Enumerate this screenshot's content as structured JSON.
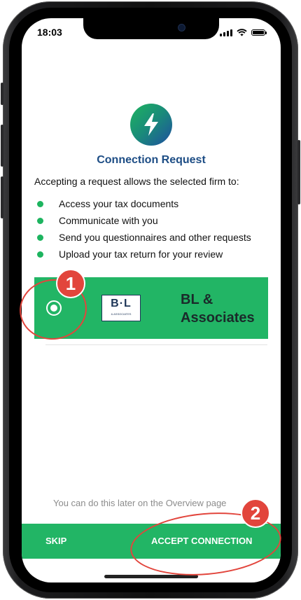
{
  "status_bar": {
    "time": "18:03"
  },
  "header": {
    "title": "Connection Request"
  },
  "intro": "Accepting a request allows the selected firm to:",
  "permissions": [
    "Access your tax documents",
    "Communicate with you",
    "Send you questionnaires and other requests",
    "Upload your tax return for your review"
  ],
  "firm": {
    "logo_text": "B·L",
    "logo_subtext": "& ASSOCIATES",
    "name_line1": "BL &",
    "name_line2": "Associates",
    "selected": true
  },
  "footer": {
    "note": "You can do this later on the Overview page",
    "skip_label": "SKIP",
    "accept_label": "ACCEPT CONNECTION"
  },
  "annotations": {
    "step1": "1",
    "step2": "2"
  },
  "colors": {
    "accent": "#22b565",
    "title": "#1d4d85",
    "annotation": "#e2453c"
  },
  "icons": {
    "logo": "lightning-bolt-icon"
  }
}
